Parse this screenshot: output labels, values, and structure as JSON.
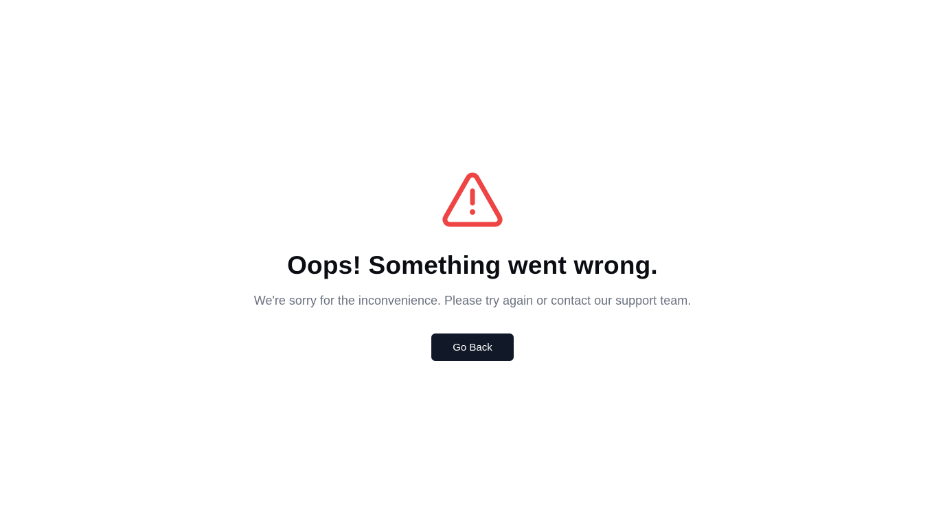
{
  "error": {
    "icon": "warning-triangle-icon",
    "icon_color": "#ef4444",
    "title": "Oops! Something went wrong.",
    "message": "We're sorry for the inconvenience. Please try again or contact our support team.",
    "button_label": "Go Back",
    "button_color": "#111827"
  }
}
